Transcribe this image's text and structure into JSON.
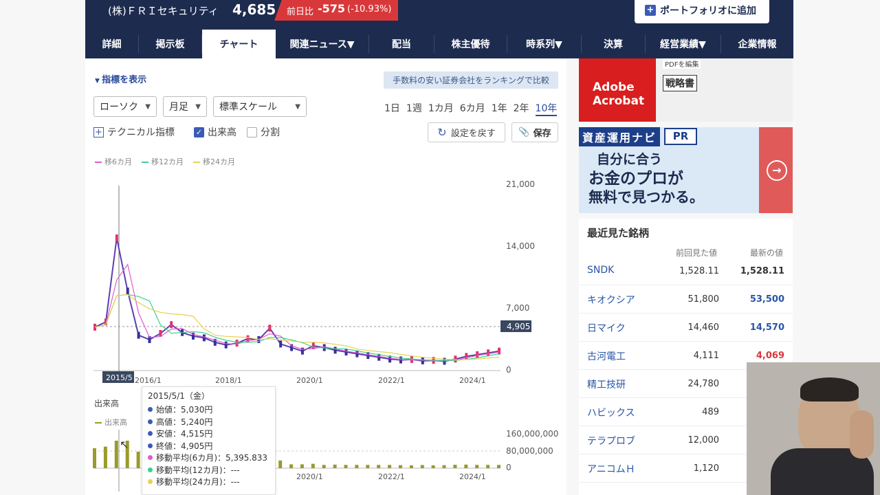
{
  "header": {
    "stock_name": "(株)ＦＲＩセキュリティ",
    "price": "4,685",
    "change_label": "前日比",
    "change_value": "-575",
    "change_pct": "(-10.93%)",
    "portfolio_button": "ポートフォリオに追加"
  },
  "nav": [
    "詳細",
    "掲示板",
    "チャート",
    "関連ニュース▼",
    "配当",
    "株主優待",
    "時系列▼",
    "決算",
    "経営業績▼",
    "企業情報"
  ],
  "controls": {
    "indicator_toggle": "指標を表示",
    "ad_link": "手数料の安い証券会社をランキングで比較",
    "chart_type": "ローソク",
    "interval": "月足",
    "scale": "標準スケール",
    "periods": [
      "1日",
      "1週",
      "1カ月",
      "6カ月",
      "1年",
      "2年",
      "10年"
    ],
    "active_period": "10年",
    "technical": "テクニカル指標",
    "volume_check": "出来高",
    "split_check": "分割",
    "reset_button": "設定を戻す",
    "save_button": "保存"
  },
  "legend": [
    "移6カ月",
    "移12カ月",
    "移24カ月"
  ],
  "volume": {
    "title": "出来高",
    "legend": "出来高"
  },
  "chart_data": {
    "type": "line",
    "price_axis": [
      "21,000",
      "14,000",
      "7,000",
      "0"
    ],
    "x_ticks": [
      "2016/1",
      "2018/1",
      "2020/1",
      "2022/1",
      "2024/1"
    ],
    "cursor_label": "2015/5",
    "last_price_label": "4,905",
    "volume_axis": [
      "160,000,000",
      "80,000,000",
      "0"
    ],
    "ylim": [
      0,
      21000
    ],
    "series": [
      {
        "x": [
          "2015/5",
          "2015/8",
          "2015/11",
          "2016/2",
          "2016/5",
          "2016/8",
          "2016/11",
          "2017/2",
          "2017/5",
          "2017/8",
          "2017/11",
          "2018/2",
          "2018/5",
          "2018/8",
          "2018/11",
          "2019/2",
          "2019/5",
          "2019/8",
          "2019/11",
          "2020/2",
          "2020/5",
          "2020/8",
          "2020/11",
          "2021/2",
          "2021/5",
          "2021/8",
          "2021/11",
          "2022/2",
          "2022/5",
          "2022/8",
          "2022/11",
          "2023/2",
          "2023/5",
          "2023/8",
          "2023/11",
          "2024/2",
          "2024/5",
          "2024/8"
        ],
        "values": [
          4905,
          5500,
          15000,
          9000,
          4000,
          3500,
          4200,
          5200,
          4300,
          3900,
          3700,
          3200,
          2900,
          3100,
          3600,
          3500,
          4800,
          3000,
          2600,
          2200,
          2800,
          2600,
          2300,
          2100,
          1900,
          1700,
          1500,
          1300,
          1200,
          1250,
          1100,
          1150,
          1050,
          1300,
          1600,
          1800,
          2000,
          2200
        ]
      }
    ]
  },
  "tooltip": {
    "date": "2015/5/1（金）",
    "open": "始値：5,030円",
    "high": "高値：5,240円",
    "low": "安値：4,515円",
    "close": "終値：4,905円",
    "ma6": "移動平均(6カ月)：5,395.833",
    "ma12": "移動平均(12カ月)：---",
    "ma24": "移動平均(24カ月)：---"
  },
  "ads": {
    "ad1_brand": "Adobe Acrobat",
    "ad1_tag": "戦略書",
    "ad1_pdf": "PDFを編集",
    "ad2_badge": "資産運用ナビ",
    "ad2_pr": "PR",
    "ad2_line1": "自分に合う",
    "ad2_line2": "お金のプロが",
    "ad2_line3": "無料で見つかる。"
  },
  "recent": {
    "title": "最近見た銘柄",
    "col_prev": "前回見た値",
    "col_last": "最新の値",
    "rows": [
      {
        "name": "SNDK",
        "prev": "1,528.11",
        "last": "1,528.11",
        "color": "#333333"
      },
      {
        "name": "キオクシア",
        "prev": "51,800",
        "last": "53,500",
        "color": "#2a55a5"
      },
      {
        "name": "日マイク",
        "prev": "14,460",
        "last": "14,570",
        "color": "#2a55a5"
      },
      {
        "name": "古河電工",
        "prev": "4,111",
        "last": "4,069",
        "color": "#d9383a"
      },
      {
        "name": "精工技研",
        "prev": "24,780",
        "last": "",
        "color": "#333333"
      },
      {
        "name": "ハビックス",
        "prev": "489",
        "last": "",
        "color": "#333333"
      },
      {
        "name": "テラプロブ",
        "prev": "12,000",
        "last": "",
        "color": "#333333"
      },
      {
        "name": "アニコムＨ",
        "prev": "1,120",
        "last": "",
        "color": "#333333"
      }
    ]
  }
}
